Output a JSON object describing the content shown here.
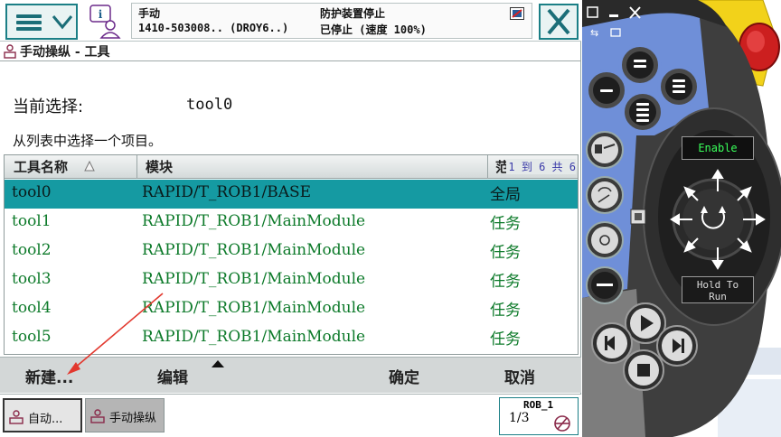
{
  "topbar": {
    "status_mode": "手动",
    "status_system": "1410-503008..  (DROY6..)",
    "status_guard": "防护装置停止",
    "status_state": "已停止 (速度 100%)"
  },
  "titlebar": {
    "title": "手动操纵 - 工具"
  },
  "selection": {
    "label": "当前选择:",
    "value": "tool0"
  },
  "hint": "从列表中选择一个项目。",
  "table": {
    "columns": [
      "工具名称",
      "模块",
      "范围"
    ],
    "count_text": "1 到 6 共 6",
    "rows": [
      {
        "name": "tool0",
        "module": "RAPID/T_ROB1/BASE",
        "scope": "全局",
        "selected": true
      },
      {
        "name": "tool1",
        "module": "RAPID/T_ROB1/MainModule",
        "scope": "任务",
        "selected": false
      },
      {
        "name": "tool2",
        "module": "RAPID/T_ROB1/MainModule",
        "scope": "任务",
        "selected": false
      },
      {
        "name": "tool3",
        "module": "RAPID/T_ROB1/MainModule",
        "scope": "任务",
        "selected": false
      },
      {
        "name": "tool4",
        "module": "RAPID/T_ROB1/MainModule",
        "scope": "任务",
        "selected": false
      },
      {
        "name": "tool5",
        "module": "RAPID/T_ROB1/MainModule",
        "scope": "任务",
        "selected": false
      }
    ]
  },
  "commands": {
    "new": "新建...",
    "edit": "编辑",
    "ok": "确定",
    "cancel": "取消"
  },
  "taskbar": {
    "auto_label": "自动...",
    "jog_label": "手动操纵",
    "robot_label": "ROB_1",
    "fraction": "1/3"
  },
  "pendant": {
    "enable_label": "Enable",
    "holdrun_line1": "Hold To",
    "holdrun_line2": "Run"
  },
  "colors": {
    "accent": "#1b7f86",
    "selected_row": "#159aa2",
    "row_text": "#0d7a2a",
    "pendant_yellow": "#f2d21a",
    "pendant_red": "#cc1f1f",
    "pendant_blue": "#6f8fd8"
  }
}
